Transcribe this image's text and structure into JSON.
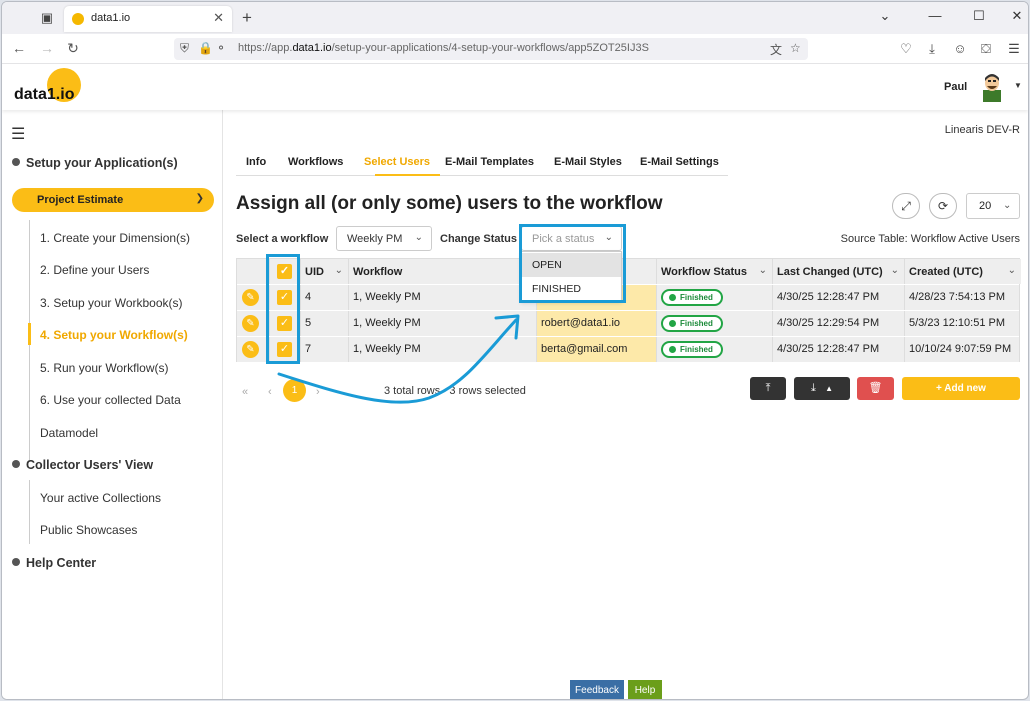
{
  "browser": {
    "tab_title": "data1.io",
    "url_prefix": "https://app.",
    "url_domain": "data1.io",
    "url_rest": "/setup-your-applications/4-setup-your-workflows/app5ZOT25IJ3S"
  },
  "header": {
    "logo": "data1.io",
    "user_name": "Paul"
  },
  "sidebar": {
    "sections": [
      "Setup your Application(s)",
      "Collector Users' View",
      "Help Center"
    ],
    "project_select": "Project Estimate",
    "setup_items": [
      "1. Create your Dimension(s)",
      "2. Define your Users",
      "3. Setup your Workbook(s)",
      "4. Setup your Workflow(s)",
      "5. Run your Workflow(s)",
      "6. Use your collected Data",
      "Datamodel"
    ],
    "active_index": 3,
    "collector_items": [
      "Your active Collections",
      "Public Showcases"
    ]
  },
  "main": {
    "tenant": "Linearis DEV-R",
    "tabs": [
      "Info",
      "Workflows",
      "Select Users",
      "E-Mail Templates",
      "E-Mail Styles",
      "E-Mail Settings"
    ],
    "selected_tab": "Select Users",
    "title": "Assign all (or only some) users to the workflow",
    "page_size": "20",
    "select_workflow_label": "Select a workflow",
    "select_workflow_value": "Weekly PM",
    "change_status_label": "Change Status",
    "status_placeholder": "Pick a status",
    "status_options": [
      "OPEN",
      "FINISHED"
    ],
    "source_table": "Source Table: Workflow Active Users"
  },
  "table": {
    "columns": [
      "UID",
      "Workflow",
      "Workflow Status",
      "Last Changed (UTC)",
      "Created (UTC)"
    ],
    "rows": [
      {
        "uid": "4",
        "workflow": "1, Weekly PM",
        "email": "",
        "status": "Finished",
        "changed": "4/30/25 12:28:47 PM",
        "created": "4/28/23 7:54:13 PM"
      },
      {
        "uid": "5",
        "workflow": "1, Weekly PM",
        "email": "robert@data1.io",
        "status": "Finished",
        "changed": "4/30/25 12:29:54 PM",
        "created": "5/3/23 12:10:51 PM"
      },
      {
        "uid": "7",
        "workflow": "1, Weekly PM",
        "email": "berta@gmail.com",
        "status": "Finished",
        "changed": "4/30/25 12:28:47 PM",
        "created": "10/10/24 9:07:59 PM"
      }
    ]
  },
  "pagination": {
    "current_page": "1",
    "total_rows": "3 total rows",
    "selected": "3 rows selected"
  },
  "actions": {
    "add_new": "+ Add new"
  },
  "footer": {
    "feedback": "Feedback",
    "help": "Help"
  },
  "colors": {
    "accent": "#fbbd16",
    "highlight": "#1a9bd6",
    "finished": "#22a545"
  }
}
